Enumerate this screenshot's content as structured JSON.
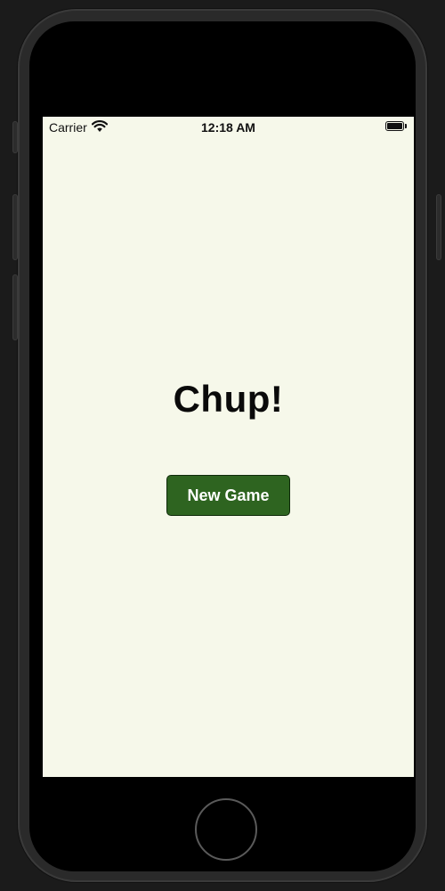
{
  "status_bar": {
    "carrier": "Carrier",
    "time": "12:18 AM",
    "wifi_icon": "wifi-icon",
    "battery_icon": "battery-icon",
    "battery_level": 1.0
  },
  "main": {
    "title": "Chup!",
    "new_game_label": "New Game"
  },
  "device": {
    "home_button_icon": "home-button-circle"
  },
  "colors": {
    "screen_background": "#f6f8ea",
    "button_background": "#2e6420",
    "button_text": "#ffffff",
    "title_text": "#0a0a0a"
  }
}
